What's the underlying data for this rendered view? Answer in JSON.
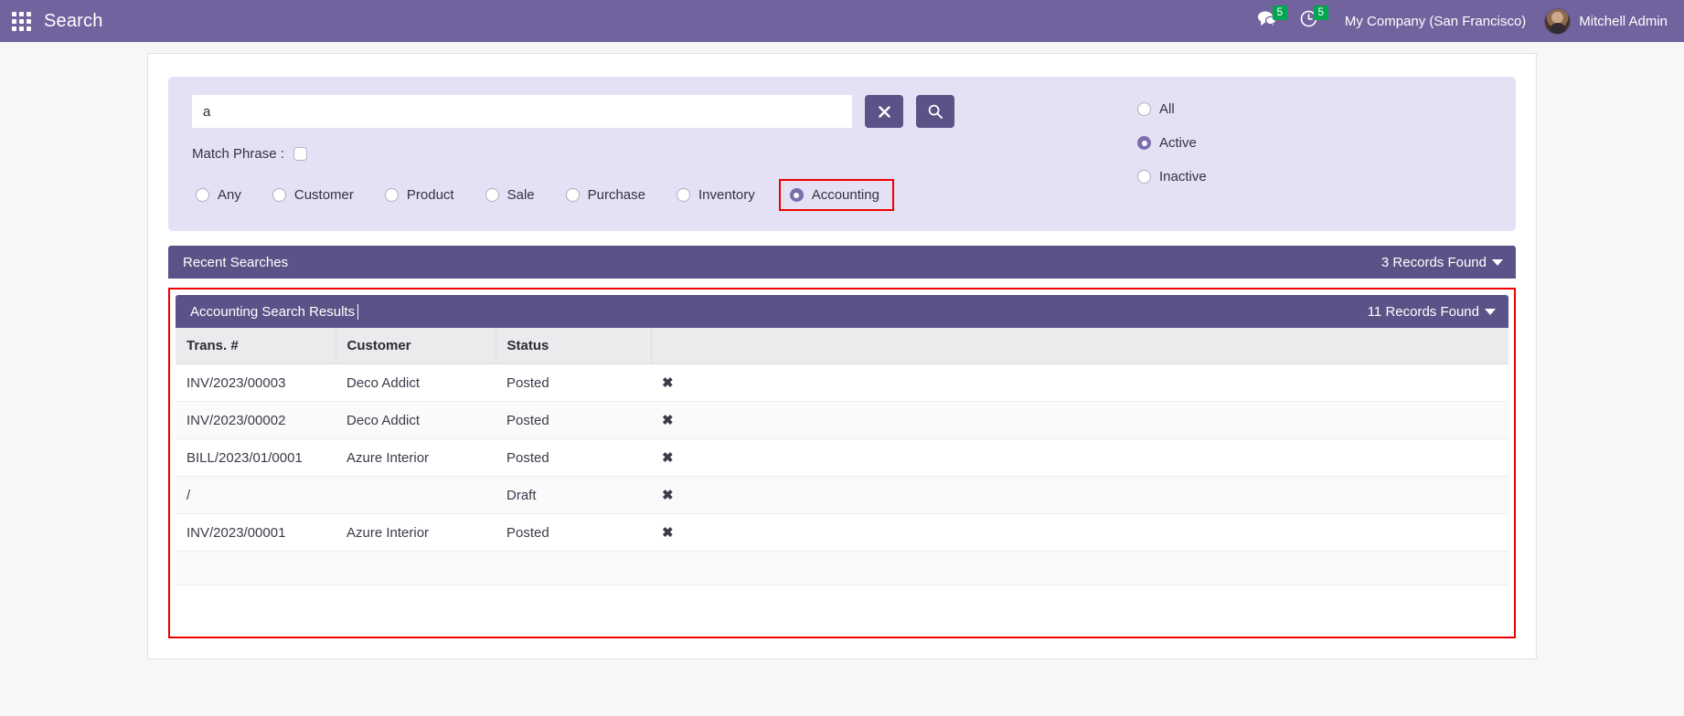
{
  "navbar": {
    "apps_icon": "apps-grid-icon",
    "brand": "Search",
    "messages": {
      "icon": "chat-bubble-icon",
      "count": "5"
    },
    "activities": {
      "icon": "clock-icon",
      "count": "5"
    },
    "company": "My Company (San Francisco)",
    "user": "Mitchell Admin",
    "accent_color": "#71639e",
    "badge_color": "#00a54f"
  },
  "filters": {
    "search": {
      "value": "a",
      "placeholder": ""
    },
    "clear_button": {
      "label": "✖",
      "name": "clear-search-button"
    },
    "search_button": {
      "label": "search",
      "name": "search-button"
    },
    "match_phrase_label": "Match Phrase :",
    "match_phrase_checked": false,
    "model_radios": [
      {
        "label": "Any",
        "selected": false
      },
      {
        "label": "Customer",
        "selected": false
      },
      {
        "label": "Product",
        "selected": false
      },
      {
        "label": "Sale",
        "selected": false
      },
      {
        "label": "Purchase",
        "selected": false
      },
      {
        "label": "Inventory",
        "selected": false
      },
      {
        "label": "Accounting",
        "selected": true,
        "highlighted": true
      }
    ],
    "state_radios": [
      {
        "label": "All",
        "selected": false
      },
      {
        "label": "Active",
        "selected": true
      },
      {
        "label": "Inactive",
        "selected": false
      }
    ],
    "panel_color": "#e4e1f5",
    "highlight_color": "#ee0000"
  },
  "recent_searches": {
    "title": "Recent Searches",
    "count_label": "3 Records Found"
  },
  "results": {
    "title": "Accounting Search Results",
    "count_label": "11 Records Found",
    "columns": [
      "Trans. #",
      "Customer",
      "Status",
      ""
    ],
    "rows": [
      {
        "trans": "INV/2023/00003",
        "customer": "Deco Addict",
        "status": "Posted",
        "delete": "✖"
      },
      {
        "trans": "INV/2023/00002",
        "customer": "Deco Addict",
        "status": "Posted",
        "delete": "✖"
      },
      {
        "trans": "BILL/2023/01/0001",
        "customer": "Azure Interior",
        "status": "Posted",
        "delete": "✖"
      },
      {
        "trans": "/",
        "customer": "",
        "status": "Draft",
        "delete": "✖"
      },
      {
        "trans": "INV/2023/00001",
        "customer": "Azure Interior",
        "status": "Posted",
        "delete": "✖"
      }
    ]
  }
}
